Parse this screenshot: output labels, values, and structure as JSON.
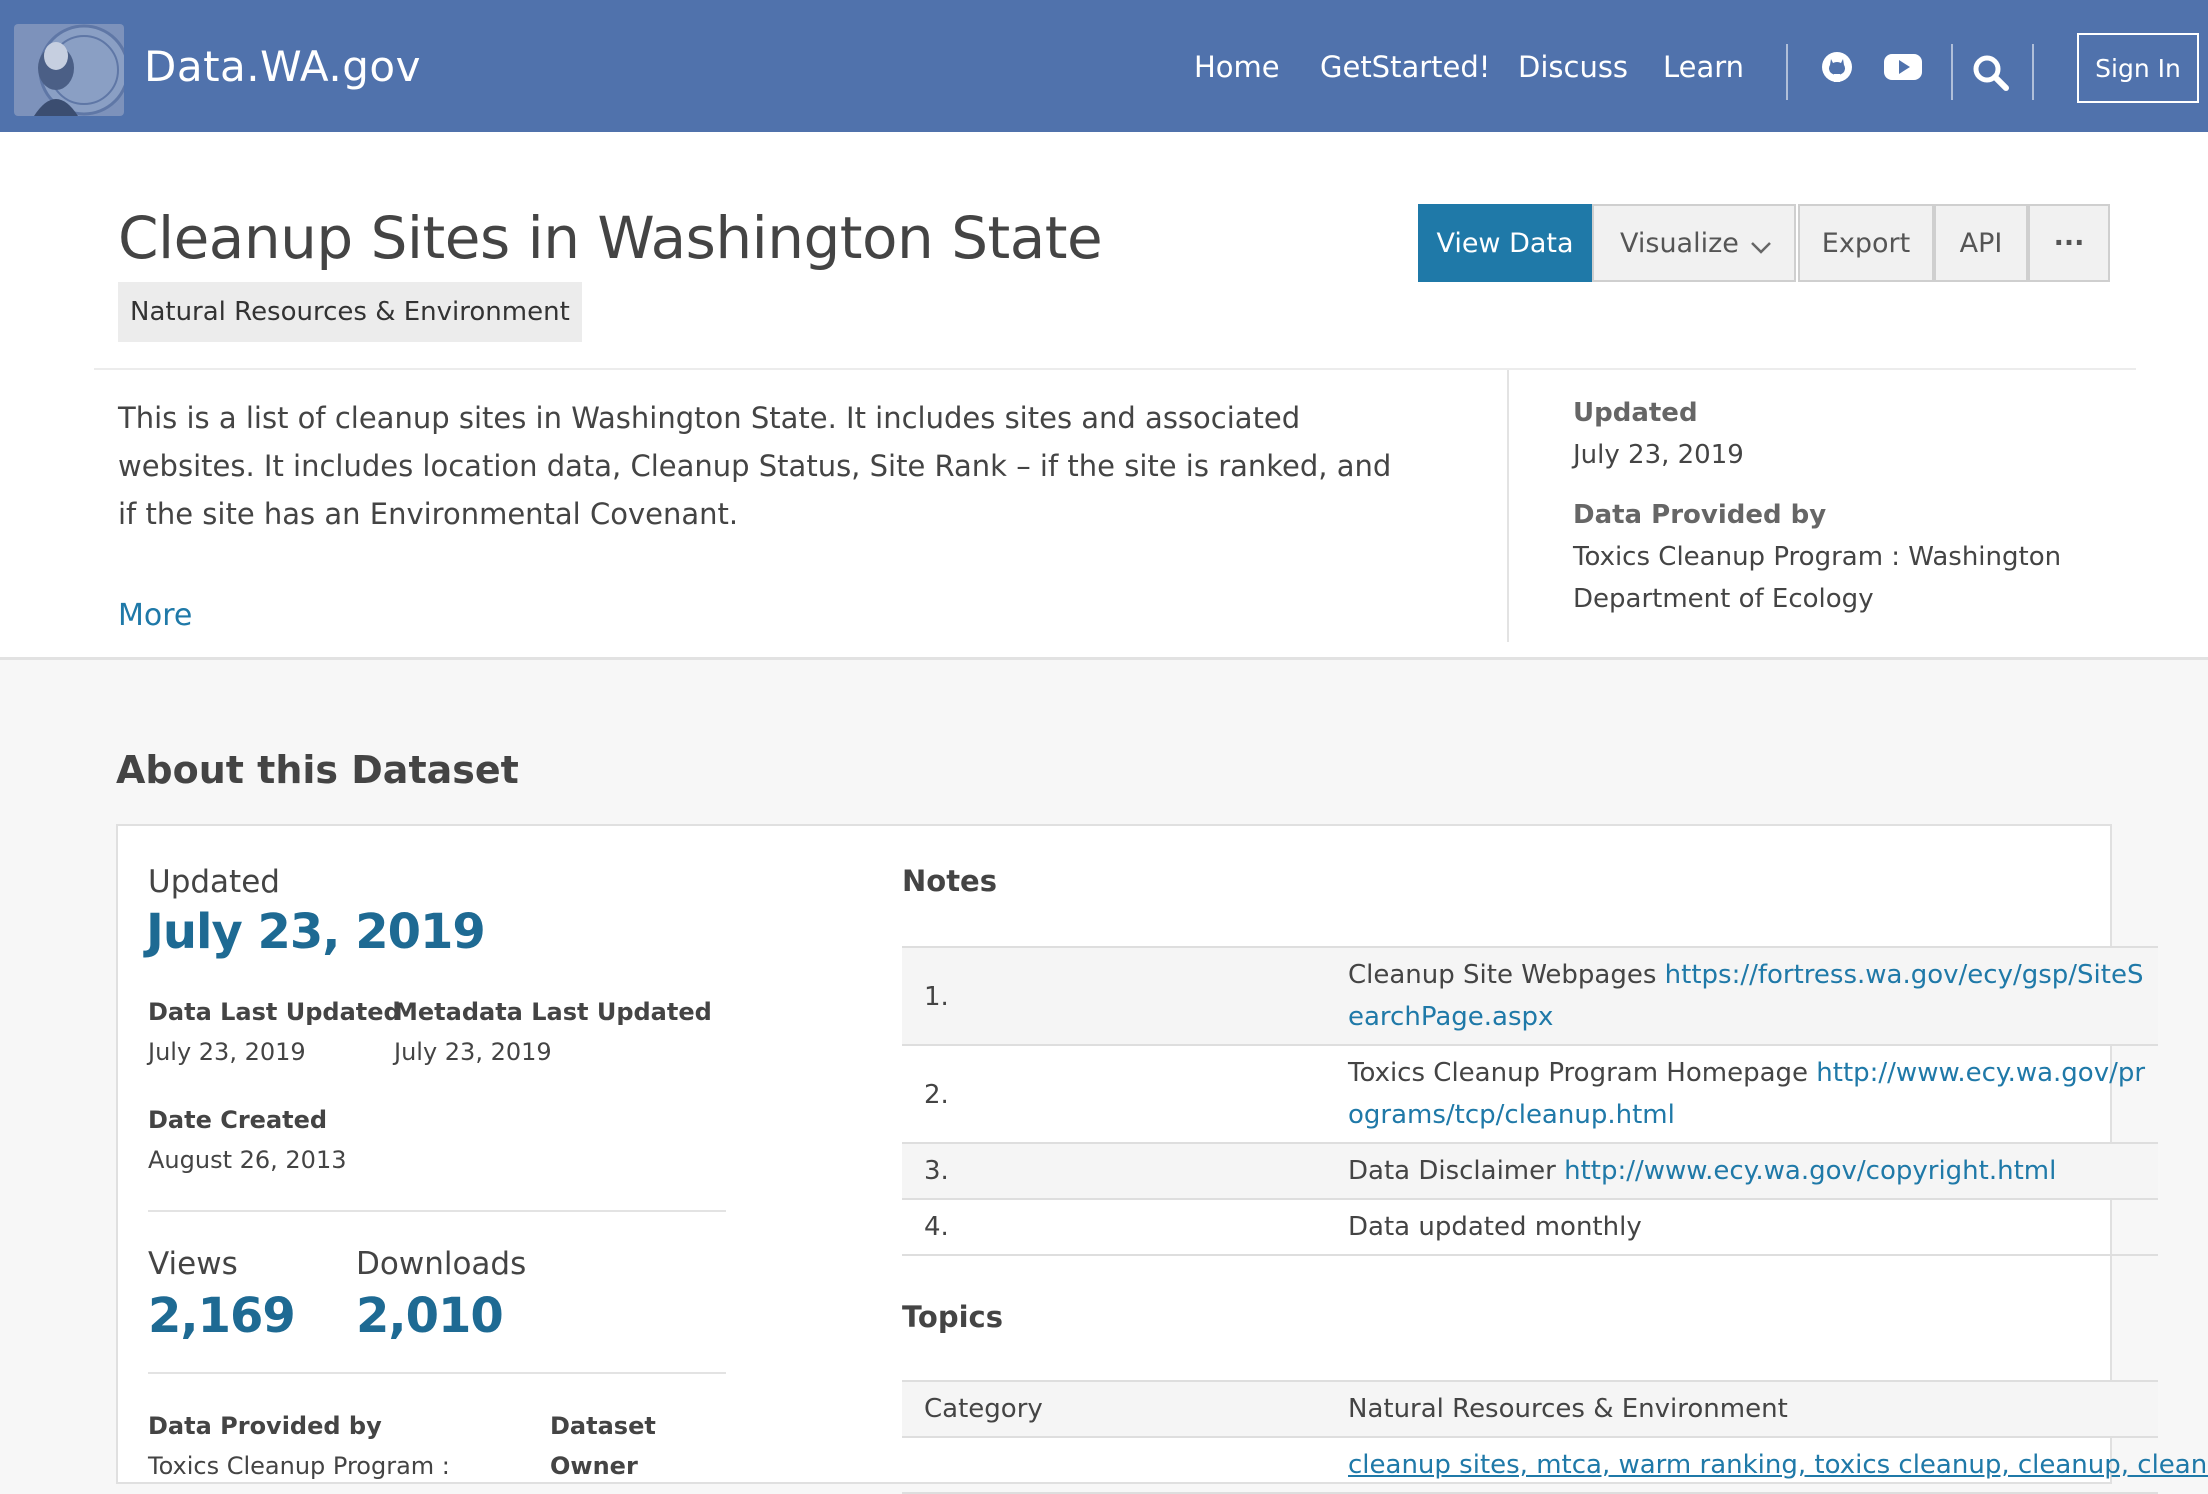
{
  "nav": {
    "brand": "Data.WA.gov",
    "links": [
      "Home",
      "GetStarted!",
      "Discuss",
      "Learn"
    ],
    "icons": [
      "github-icon",
      "youtube-icon",
      "search-icon"
    ],
    "signin": "Sign In",
    "bg_color": "#5072ac"
  },
  "dataset": {
    "title": "Cleanup Sites in Washington State",
    "category": "Natural Resources & Environment",
    "description": "This is a list of cleanup sites in Washington State. It includes sites and associated websites. It includes location data, Cleanup Status, Site Rank – if the site is ranked, and if the site has an Environmental Covenant.",
    "more": "More",
    "actions": {
      "view_data": "View Data",
      "visualize": "Visualize",
      "export": "Export",
      "api": "API",
      "more_menu": "···"
    },
    "sidebar": {
      "updated_label": "Updated",
      "updated_value": "July 23, 2019",
      "provided_label": "Data Provided by",
      "provided_value": "Toxics Cleanup Program : Washington Department of Ecology"
    }
  },
  "about": {
    "heading": "About this Dataset",
    "updated_label": "Updated",
    "updated_value": "July 23, 2019",
    "data_last_updated_label": "Data Last Updated",
    "data_last_updated_value": "July 23, 2019",
    "metadata_last_updated_label": "Metadata Last Updated",
    "metadata_last_updated_value": "July 23, 2019",
    "date_created_label": "Date Created",
    "date_created_value": "August 26, 2013",
    "views_label": "Views",
    "views_value": "2,169",
    "downloads_label": "Downloads",
    "downloads_value": "2,010",
    "data_provided_label": "Data Provided by",
    "data_provided_value": "Toxics Cleanup Program :",
    "dataset_owner_label_line1": "Dataset",
    "dataset_owner_label_line2": "Owner"
  },
  "notes": {
    "title": "Notes",
    "rows": [
      {
        "num": "1.",
        "text": "Cleanup Site Webpages ",
        "link": "https://fortress.wa.gov/ecy/gsp/SiteSearchPage.aspx"
      },
      {
        "num": "2.",
        "text": "Toxics Cleanup Program Homepage ",
        "link": "http://www.ecy.wa.gov/programs/tcp/cleanup.html"
      },
      {
        "num": "3.",
        "text": "Data Disclaimer ",
        "link": "http://www.ecy.wa.gov/copyright.html"
      },
      {
        "num": "4.",
        "text": "Data updated monthly",
        "link": ""
      }
    ]
  },
  "topics": {
    "title": "Topics",
    "category_label": "Category",
    "category_value": "Natural Resources & Environment",
    "tags": "cleanup sites, mtca, warm ranking, toxics cleanup, cleanup, cleanu"
  }
}
